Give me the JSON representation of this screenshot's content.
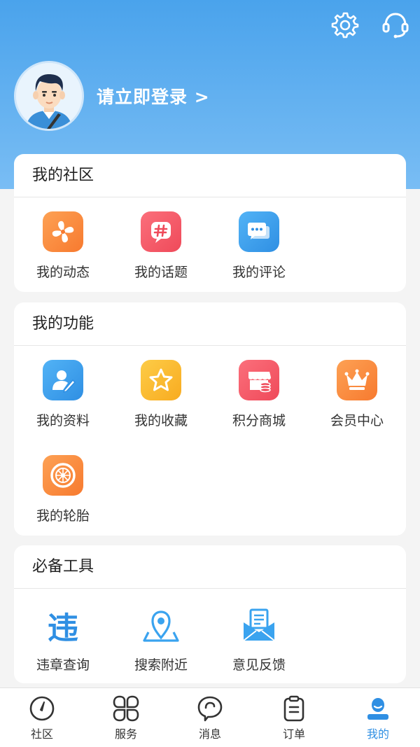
{
  "header": {
    "login_prompt": "请立即登录 >",
    "settings_icon": "gear-icon",
    "support_icon": "headset-icon"
  },
  "community": {
    "title": "我的社区",
    "items": [
      {
        "label": "我的动态",
        "icon": "pinwheel-icon",
        "color": "#fb8c3c"
      },
      {
        "label": "我的话题",
        "icon": "hashtag-icon",
        "color": "#f55a68"
      },
      {
        "label": "我的评论",
        "icon": "comment-icon",
        "color": "#3aa3ef"
      }
    ]
  },
  "functions": {
    "title": "我的功能",
    "items": [
      {
        "label": "我的资料",
        "icon": "profile-edit-icon",
        "color": "#3aa3ef"
      },
      {
        "label": "我的收藏",
        "icon": "star-icon",
        "color": "#fbbf2f"
      },
      {
        "label": "积分商城",
        "icon": "store-icon",
        "color": "#f55a68"
      },
      {
        "label": "会员中心",
        "icon": "crown-icon",
        "color": "#fb8c3c"
      },
      {
        "label": "我的轮胎",
        "icon": "tire-icon",
        "color": "#fb8c3c"
      }
    ]
  },
  "tools": {
    "title": "必备工具",
    "items": [
      {
        "label": "违章查询",
        "icon": "violation-icon",
        "glyph": "违"
      },
      {
        "label": "搜索附近",
        "icon": "map-pin-icon"
      },
      {
        "label": "意见反馈",
        "icon": "feedback-envelope-icon"
      }
    ]
  },
  "tabbar": {
    "tabs": [
      {
        "label": "社区",
        "icon": "compass-icon"
      },
      {
        "label": "服务",
        "icon": "grid-petals-icon"
      },
      {
        "label": "消息",
        "icon": "message-bubble-icon"
      },
      {
        "label": "订单",
        "icon": "clipboard-icon"
      },
      {
        "label": "我的",
        "icon": "person-icon",
        "active": true
      }
    ],
    "active_color": "#2f8fe3"
  }
}
